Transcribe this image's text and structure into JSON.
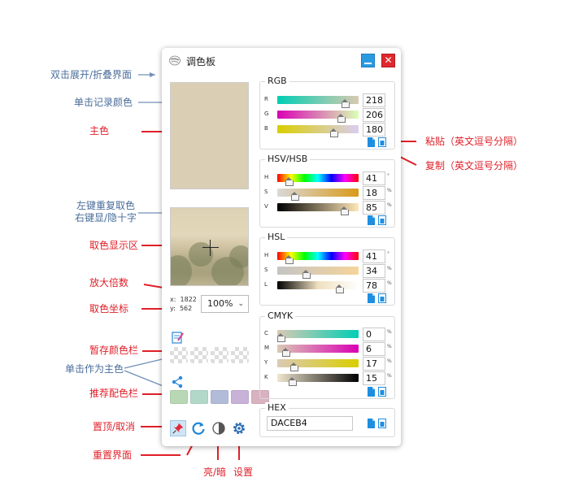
{
  "window": {
    "title": "调色板"
  },
  "annotations": {
    "expand": "双击展开/折叠界面",
    "record": "单击记录颜色",
    "main_color": "主色",
    "resample_1": "左键重复取色",
    "resample_2": "右键显/隐十字",
    "display_area": "取色显示区",
    "zoom": "放大倍数",
    "coords": "取色坐标",
    "temp_bar": "暂存颜色栏",
    "click_main": "单击作为主色",
    "recommend_bar": "推荐配色栏",
    "pin": "置顶/取消",
    "reset": "重置界面",
    "theme": "亮/暗",
    "settings": "设置",
    "paste": "粘贴（英文逗号分隔）",
    "copy": "复制（英文逗号分隔）"
  },
  "main_color": "#DACEB4",
  "coords": {
    "x_label": "x:",
    "x": "1822",
    "y_label": "y:",
    "y": "562"
  },
  "zoom": {
    "value": "100%"
  },
  "recommended_colors": [
    "#b7d7b5",
    "#b2d8c9",
    "#b2bcd8",
    "#c8b2d8",
    "#d8b2c0"
  ],
  "rgb": {
    "label": "RGB",
    "rows": [
      {
        "ch": "R",
        "value": "218",
        "fraction": 0.855
      },
      {
        "ch": "G",
        "value": "206",
        "fraction": 0.808
      },
      {
        "ch": "B",
        "value": "180",
        "fraction": 0.706
      }
    ]
  },
  "hsv": {
    "label": "HSV/HSB",
    "rows": [
      {
        "ch": "H",
        "value": "41",
        "unit": "°",
        "fraction": 0.114
      },
      {
        "ch": "S",
        "value": "18",
        "unit": "%",
        "fraction": 0.18
      },
      {
        "ch": "V",
        "value": "85",
        "unit": "%",
        "fraction": 0.85
      }
    ]
  },
  "hsl": {
    "label": "HSL",
    "rows": [
      {
        "ch": "H",
        "value": "41",
        "unit": "°",
        "fraction": 0.114
      },
      {
        "ch": "S",
        "value": "34",
        "unit": "%",
        "fraction": 0.34
      },
      {
        "ch": "L",
        "value": "78",
        "unit": "%",
        "fraction": 0.78
      }
    ]
  },
  "cmyk": {
    "label": "CMYK",
    "rows": [
      {
        "ch": "C",
        "value": "0",
        "unit": "%",
        "fraction": 0.0
      },
      {
        "ch": "M",
        "value": "6",
        "unit": "%",
        "fraction": 0.06
      },
      {
        "ch": "Y",
        "value": "17",
        "unit": "%",
        "fraction": 0.17
      },
      {
        "ch": "K",
        "value": "15",
        "unit": "%",
        "fraction": 0.15
      }
    ]
  },
  "hex": {
    "label": "HEX",
    "value": "DACEB4"
  },
  "icons": {
    "app": "palette-icon",
    "paste": "paste-icon",
    "copy": "copy-icon",
    "temp": "notepad-icon",
    "recommend": "share-icon",
    "pin": "pin-icon",
    "reset": "refresh-icon",
    "theme": "contrast-icon",
    "settings": "gear-icon"
  }
}
